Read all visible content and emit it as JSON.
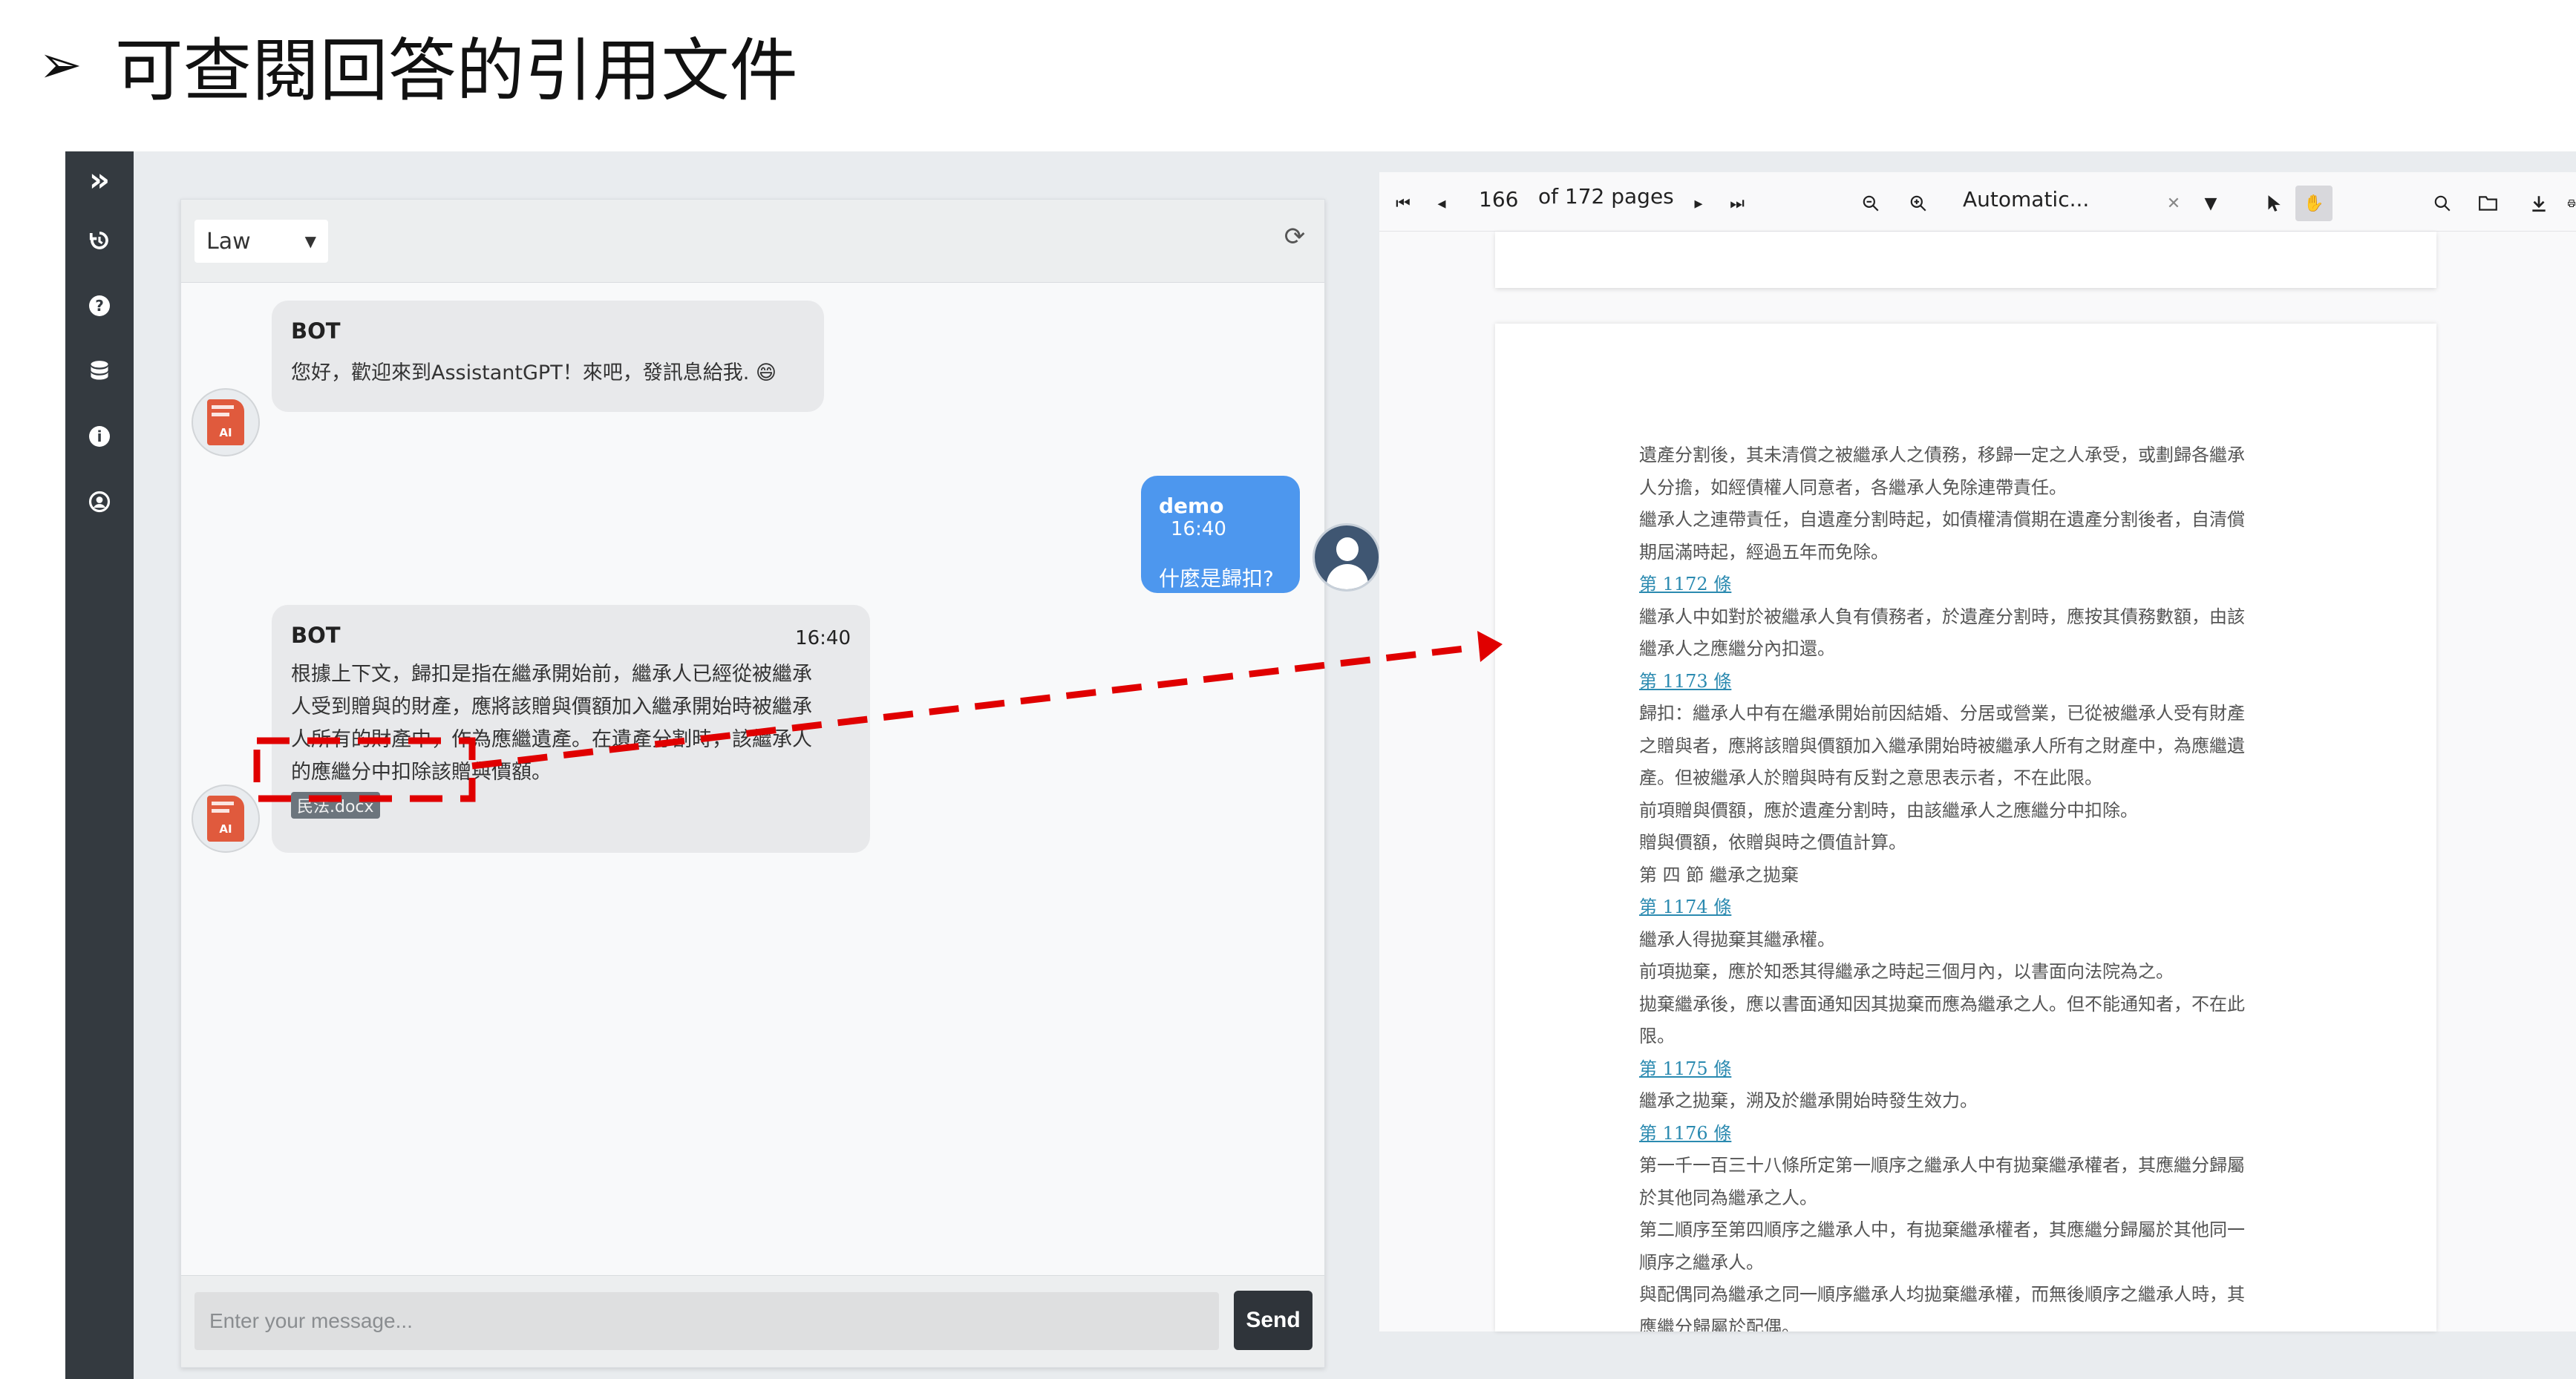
{
  "slide": {
    "bullet": "➢",
    "title": "可查閱回答的引用文件"
  },
  "rail": {
    "toggle_icon": "»"
  },
  "chat": {
    "select_value": "Law",
    "messages": [
      {
        "sender": "BOT",
        "time": "",
        "text": "您好，歡迎來到AssistantGPT！來吧，發訊息給我. 😄"
      },
      {
        "sender": "demo",
        "time": "16:40",
        "text": "什麼是歸扣?"
      },
      {
        "sender": "BOT",
        "time": "16:40",
        "lines": [
          "根據上下文，歸扣是指在繼承開始前，繼承人已經從被繼承",
          "人受到贈與的財產，應將該贈與價額加入繼承開始時被繼承",
          "人所有的財產中，作為應繼遺產。在遺產分割時，該繼承人",
          "的應繼分中扣除該贈與價額。"
        ],
        "source": "民法.docx"
      }
    ],
    "input_placeholder": "Enter your message...",
    "send_label": "Send"
  },
  "viewer": {
    "page_current": "166",
    "page_total_label": "of 172 pages",
    "zoom_label": "Automatic...",
    "doc_lines": [
      {
        "text": "遺產分割後，其未清償之被繼承人之債務，移歸一定之人承受，或劃歸各繼承",
        "link": false
      },
      {
        "text": "人分擔，如經債權人同意者，各繼承人免除連帶責任。",
        "link": false
      },
      {
        "text": "繼承人之連帶責任，自遺產分割時起，如債權清償期在遺產分割後者，自清償",
        "link": false
      },
      {
        "text": "期屆滿時起，經過五年而免除。",
        "link": false
      },
      {
        "text": "第 1172 條",
        "link": true
      },
      {
        "text": "繼承人中如對於被繼承人負有債務者，於遺產分割時，應按其債務數額，由該",
        "link": false
      },
      {
        "text": "繼承人之應繼分內扣還。",
        "link": false
      },
      {
        "text": "第 1173 條",
        "link": true
      },
      {
        "text": "歸扣：繼承人中有在繼承開始前因結婚、分居或營業，已從被繼承人受有財產",
        "link": false
      },
      {
        "text": "之贈與者，應將該贈與價額加入繼承開始時被繼承人所有之財產中，為應繼遺",
        "link": false
      },
      {
        "text": "產。但被繼承人於贈與時有反對之意思表示者，不在此限。",
        "link": false
      },
      {
        "text": "前項贈與價額，應於遺產分割時，由該繼承人之應繼分中扣除。",
        "link": false
      },
      {
        "text": "贈與價額，依贈與時之價值計算。",
        "link": false
      },
      {
        "text": "第 四 節 繼承之拋棄",
        "link": false
      },
      {
        "text": "第 1174 條",
        "link": true
      },
      {
        "text": "繼承人得拋棄其繼承權。",
        "link": false
      },
      {
        "text": "前項拋棄，應於知悉其得繼承之時起三個月內，以書面向法院為之。",
        "link": false
      },
      {
        "text": "拋棄繼承後，應以書面通知因其拋棄而應為繼承之人。但不能通知者，不在此",
        "link": false
      },
      {
        "text": "限。",
        "link": false
      },
      {
        "text": "第 1175 條",
        "link": true
      },
      {
        "text": "繼承之拋棄，溯及於繼承開始時發生效力。",
        "link": false
      },
      {
        "text": "第 1176 條",
        "link": true
      },
      {
        "text": "第一千一百三十八條所定第一順序之繼承人中有拋棄繼承權者，其應繼分歸屬",
        "link": false
      },
      {
        "text": "於其他同為繼承之人。",
        "link": false
      },
      {
        "text": "第二順序至第四順序之繼承人中，有拋棄繼承權者，其應繼分歸屬於其他同一",
        "link": false
      },
      {
        "text": "順序之繼承人。",
        "link": false
      },
      {
        "text": "與配偶同為繼承之同一順序繼承人均拋棄繼承權，而無後順序之繼承人時，其",
        "link": false
      },
      {
        "text": "應繼分歸屬於配偶。",
        "link": false
      }
    ]
  },
  "colors": {
    "callout": "#e00000",
    "user_bubble": "#4d97ee",
    "rail": "#343a40"
  }
}
